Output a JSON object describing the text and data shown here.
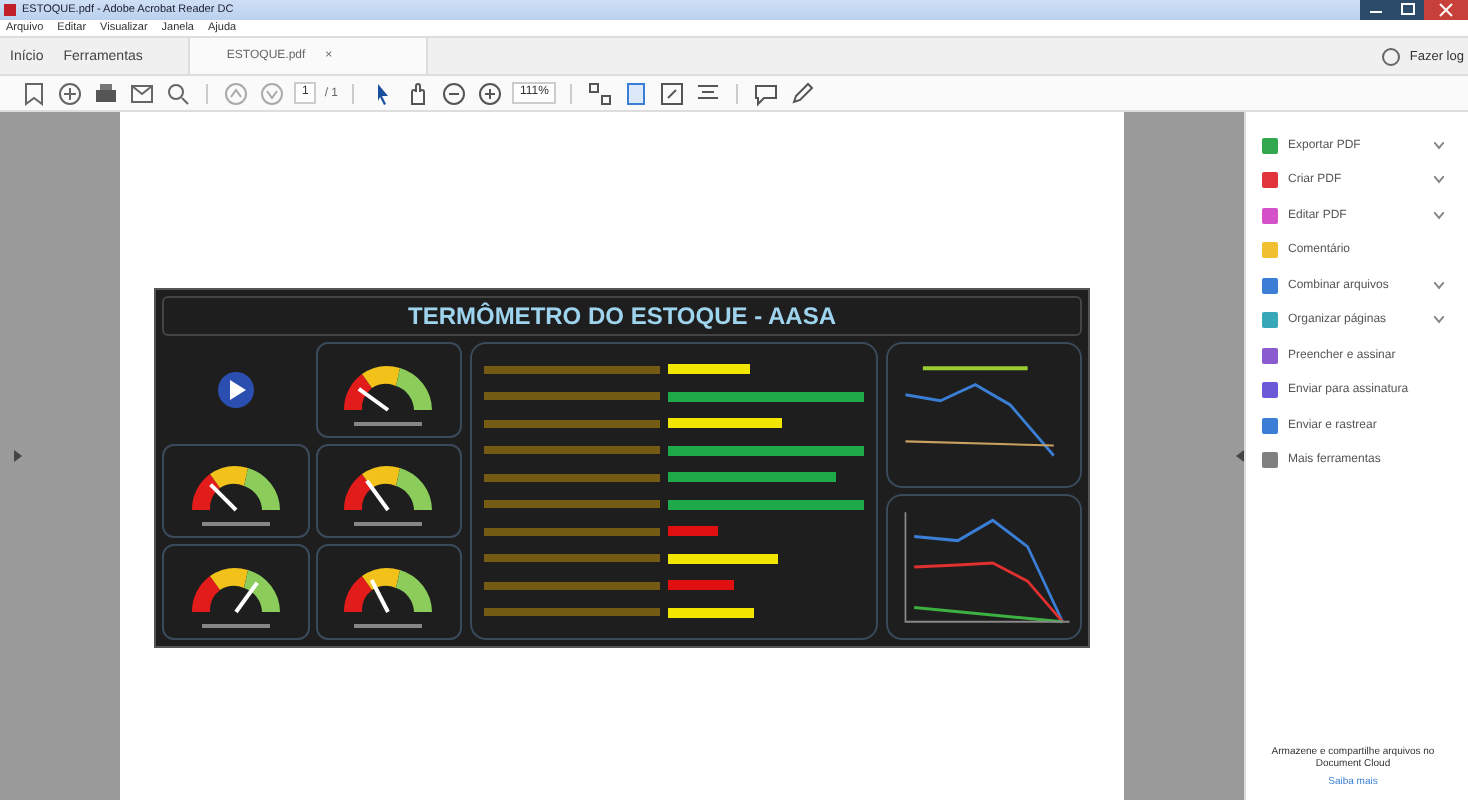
{
  "window": {
    "title": "ESTOQUE.pdf - Adobe Acrobat Reader DC"
  },
  "menu": [
    "Arquivo",
    "Editar",
    "Visualizar",
    "Janela",
    "Ajuda"
  ],
  "tabs": [
    {
      "label": "Início",
      "selected": false
    },
    {
      "label": "Ferramentas",
      "selected": false
    }
  ],
  "document_tab": {
    "label": "ESTOQUE.pdf",
    "close": "×"
  },
  "account": {
    "label": "Fazer log"
  },
  "toolbar": {
    "page_number": "1",
    "page_count": "/ 1",
    "zoom": "111%"
  },
  "dashboard": {
    "title": "TERMÔMETRO DO ESTOQUE - AASA",
    "bars": [
      {
        "color": "#f2e600"
      },
      {
        "color": "#1faa4a"
      },
      {
        "color": "#f2e600"
      },
      {
        "color": "#1faa4a"
      },
      {
        "color": "#1faa4a"
      },
      {
        "color": "#1faa4a"
      },
      {
        "color": "#e01010"
      },
      {
        "color": "#f2e600"
      },
      {
        "color": "#e01010"
      },
      {
        "color": "#f2e600"
      }
    ]
  },
  "tools": [
    {
      "label": "Exportar PDF",
      "color": "#2fa84f",
      "has_menu": true
    },
    {
      "label": "Criar PDF",
      "color": "#e0343a",
      "has_menu": true
    },
    {
      "label": "Editar PDF",
      "color": "#d452c8",
      "has_menu": true
    },
    {
      "label": "Comentário",
      "color": "#f0c030",
      "has_menu": false
    },
    {
      "label": "Combinar arquivos",
      "color": "#3a7fd5",
      "has_menu": true
    },
    {
      "label": "Organizar páginas",
      "color": "#38a8b8",
      "has_menu": true
    },
    {
      "label": "Preencher e assinar",
      "color": "#8a5ad0",
      "has_menu": false
    },
    {
      "label": "Enviar para assinatura",
      "color": "#6a5ad8",
      "has_menu": false
    },
    {
      "label": "Enviar e rastrear",
      "color": "#3a7fd5",
      "has_menu": false
    },
    {
      "label": "Mais ferramentas",
      "color": "#808080",
      "has_menu": false
    }
  ],
  "cloud_promo": {
    "text": "Armazene e compartilhe arquivos no Document Cloud",
    "link": "Saiba mais"
  }
}
